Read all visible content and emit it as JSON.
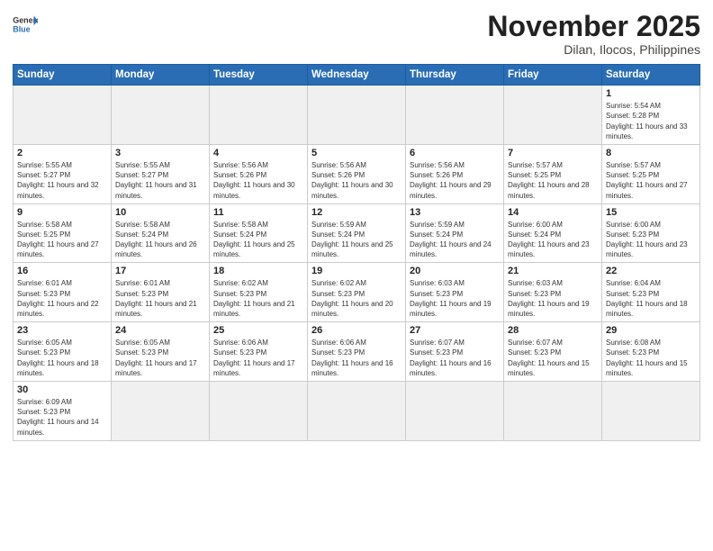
{
  "header": {
    "logo_general": "General",
    "logo_blue": "Blue",
    "title": "November 2025",
    "subtitle": "Dilan, Ilocos, Philippines"
  },
  "weekdays": [
    "Sunday",
    "Monday",
    "Tuesday",
    "Wednesday",
    "Thursday",
    "Friday",
    "Saturday"
  ],
  "days": {
    "1": {
      "sunrise": "5:54 AM",
      "sunset": "5:28 PM",
      "daylight": "11 hours and 33 minutes."
    },
    "2": {
      "sunrise": "5:55 AM",
      "sunset": "5:27 PM",
      "daylight": "11 hours and 32 minutes."
    },
    "3": {
      "sunrise": "5:55 AM",
      "sunset": "5:27 PM",
      "daylight": "11 hours and 31 minutes."
    },
    "4": {
      "sunrise": "5:56 AM",
      "sunset": "5:26 PM",
      "daylight": "11 hours and 30 minutes."
    },
    "5": {
      "sunrise": "5:56 AM",
      "sunset": "5:26 PM",
      "daylight": "11 hours and 30 minutes."
    },
    "6": {
      "sunrise": "5:56 AM",
      "sunset": "5:26 PM",
      "daylight": "11 hours and 29 minutes."
    },
    "7": {
      "sunrise": "5:57 AM",
      "sunset": "5:25 PM",
      "daylight": "11 hours and 28 minutes."
    },
    "8": {
      "sunrise": "5:57 AM",
      "sunset": "5:25 PM",
      "daylight": "11 hours and 27 minutes."
    },
    "9": {
      "sunrise": "5:58 AM",
      "sunset": "5:25 PM",
      "daylight": "11 hours and 27 minutes."
    },
    "10": {
      "sunrise": "5:58 AM",
      "sunset": "5:24 PM",
      "daylight": "11 hours and 26 minutes."
    },
    "11": {
      "sunrise": "5:58 AM",
      "sunset": "5:24 PM",
      "daylight": "11 hours and 25 minutes."
    },
    "12": {
      "sunrise": "5:59 AM",
      "sunset": "5:24 PM",
      "daylight": "11 hours and 25 minutes."
    },
    "13": {
      "sunrise": "5:59 AM",
      "sunset": "5:24 PM",
      "daylight": "11 hours and 24 minutes."
    },
    "14": {
      "sunrise": "6:00 AM",
      "sunset": "5:24 PM",
      "daylight": "11 hours and 23 minutes."
    },
    "15": {
      "sunrise": "6:00 AM",
      "sunset": "5:23 PM",
      "daylight": "11 hours and 23 minutes."
    },
    "16": {
      "sunrise": "6:01 AM",
      "sunset": "5:23 PM",
      "daylight": "11 hours and 22 minutes."
    },
    "17": {
      "sunrise": "6:01 AM",
      "sunset": "5:23 PM",
      "daylight": "11 hours and 21 minutes."
    },
    "18": {
      "sunrise": "6:02 AM",
      "sunset": "5:23 PM",
      "daylight": "11 hours and 21 minutes."
    },
    "19": {
      "sunrise": "6:02 AM",
      "sunset": "5:23 PM",
      "daylight": "11 hours and 20 minutes."
    },
    "20": {
      "sunrise": "6:03 AM",
      "sunset": "5:23 PM",
      "daylight": "11 hours and 19 minutes."
    },
    "21": {
      "sunrise": "6:03 AM",
      "sunset": "5:23 PM",
      "daylight": "11 hours and 19 minutes."
    },
    "22": {
      "sunrise": "6:04 AM",
      "sunset": "5:23 PM",
      "daylight": "11 hours and 18 minutes."
    },
    "23": {
      "sunrise": "6:05 AM",
      "sunset": "5:23 PM",
      "daylight": "11 hours and 18 minutes."
    },
    "24": {
      "sunrise": "6:05 AM",
      "sunset": "5:23 PM",
      "daylight": "11 hours and 17 minutes."
    },
    "25": {
      "sunrise": "6:06 AM",
      "sunset": "5:23 PM",
      "daylight": "11 hours and 17 minutes."
    },
    "26": {
      "sunrise": "6:06 AM",
      "sunset": "5:23 PM",
      "daylight": "11 hours and 16 minutes."
    },
    "27": {
      "sunrise": "6:07 AM",
      "sunset": "5:23 PM",
      "daylight": "11 hours and 16 minutes."
    },
    "28": {
      "sunrise": "6:07 AM",
      "sunset": "5:23 PM",
      "daylight": "11 hours and 15 minutes."
    },
    "29": {
      "sunrise": "6:08 AM",
      "sunset": "5:23 PM",
      "daylight": "11 hours and 15 minutes."
    },
    "30": {
      "sunrise": "6:09 AM",
      "sunset": "5:23 PM",
      "daylight": "11 hours and 14 minutes."
    }
  }
}
